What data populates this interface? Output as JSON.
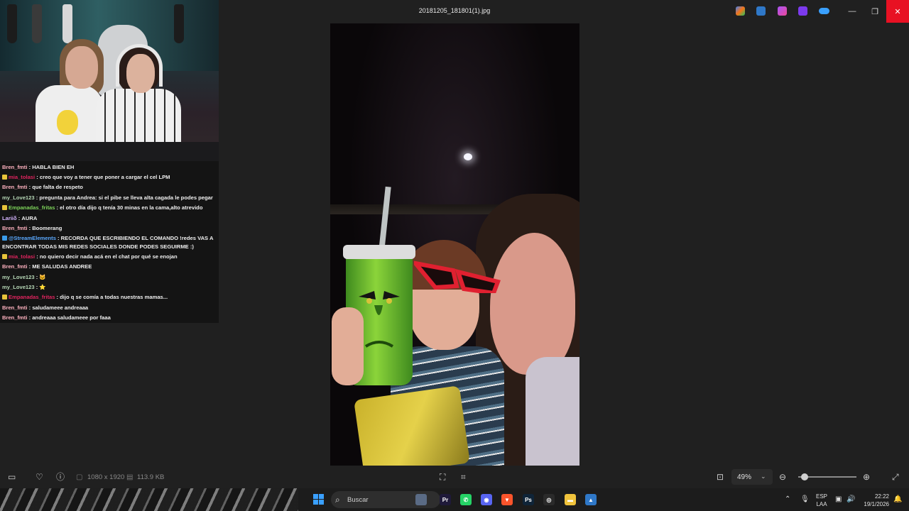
{
  "window": {
    "title": "20181205_181801(1).jpg",
    "controls": {
      "minimize": "—",
      "maximize": "❐",
      "close": "✕"
    },
    "title_apps": [
      "copilot-icon",
      "photos-editor-icon",
      "clipchamp-icon",
      "video-editor-icon",
      "onedrive-icon"
    ]
  },
  "chat": {
    "messages": [
      {
        "user": "Bren_fmti",
        "user_color": "#ffb3c0",
        "text": " : HABLA BIEN EH",
        "badge": ""
      },
      {
        "user": "mia_tolasi",
        "user_color": "#e0245e",
        "text": " : creo que voy a tener que poner a cargar el cel LPM",
        "badge": "#e8c43a"
      },
      {
        "user": "Bren_fmti",
        "user_color": "#ffb3c0",
        "text": " : que falta de respeto",
        "badge": ""
      },
      {
        "user": "my_Love123",
        "user_color": "#b7d8b7",
        "text": " : pregunta para Andrea: si el pibe se lleva alta cagada le podes pegar",
        "badge": ""
      },
      {
        "user": "Empanadas_fritas",
        "user_color": "#7dd35a",
        "text": " : el otro día dijo q tenía 30 minas en la cama,alto atrevido",
        "badge": "#e8c43a"
      },
      {
        "user": "Lariiδ",
        "user_color": "#d6b6ff",
        "text": " : AURA",
        "badge": ""
      },
      {
        "user": "Bren_fmti",
        "user_color": "#ffb3c0",
        "text": " : Boomerang",
        "badge": ""
      },
      {
        "user": "@StreamElements",
        "user_color": "#5aa9ff",
        "text": " : RECORDA QUE ESCRIBIENDO EL COMANDO !redes VAS A ENCONTRAR TODAS MIS REDES SOCIALES DONDE PODES SEGUIRME :)",
        "badge": "#3a9be8"
      },
      {
        "user": "mia_tolasi",
        "user_color": "#e0245e",
        "text": " : no quiero decir nada acá en el chat por qué se enojan",
        "badge": "#e8c43a"
      },
      {
        "user": "Bren_fmti",
        "user_color": "#ffb3c0",
        "text": " : ME SALUDAS ANDREE",
        "badge": ""
      },
      {
        "user": "my_Love123",
        "user_color": "#b7d8b7",
        "text": " : 🐱",
        "badge": ""
      },
      {
        "user": "my_Love123",
        "user_color": "#b7d8b7",
        "text": " : ⭐",
        "badge": ""
      },
      {
        "user": "Empanadas_fritas",
        "user_color": "#e0245e",
        "text": " : dijo q se comía a todas nuestras mamas...",
        "badge": "#e8c43a"
      },
      {
        "user": "Bren_fmti",
        "user_color": "#ffb3c0",
        "text": " : saludameee andreaaa",
        "badge": ""
      },
      {
        "user": "Bren_fmti",
        "user_color": "#ffb3c0",
        "text": " : andreaaa saludameee por faaa",
        "badge": ""
      }
    ]
  },
  "toolbar": {
    "dimensions": "1080 x 1920",
    "file_size": "113.9 KB",
    "zoom": "49%",
    "zoom_fraction": 0.05
  },
  "taskbar": {
    "search_placeholder": "Buscar",
    "lang_top": "ESP",
    "lang_bottom": "LAA",
    "time": "22:22",
    "date": "19/1/2026",
    "apps": [
      {
        "name": "weather-icon",
        "glyph": "",
        "color": "#5a6b85"
      },
      {
        "name": "premiere-icon",
        "glyph": "Pr",
        "color": "#1f1a3a"
      },
      {
        "name": "whatsapp-icon",
        "glyph": "✆",
        "color": "#25d366"
      },
      {
        "name": "discord-icon",
        "glyph": "◉",
        "color": "#5865f2"
      },
      {
        "name": "brave-icon",
        "glyph": "▼",
        "color": "#fb542b"
      },
      {
        "name": "photoshop-icon",
        "glyph": "Ps",
        "color": "#0f2438"
      },
      {
        "name": "obs-icon",
        "glyph": "◎",
        "color": "#2a2a2a"
      },
      {
        "name": "explorer-icon",
        "glyph": "▬",
        "color": "#f0c33c"
      },
      {
        "name": "photos-app-icon",
        "glyph": "▲",
        "color": "#2f78c8"
      }
    ]
  }
}
